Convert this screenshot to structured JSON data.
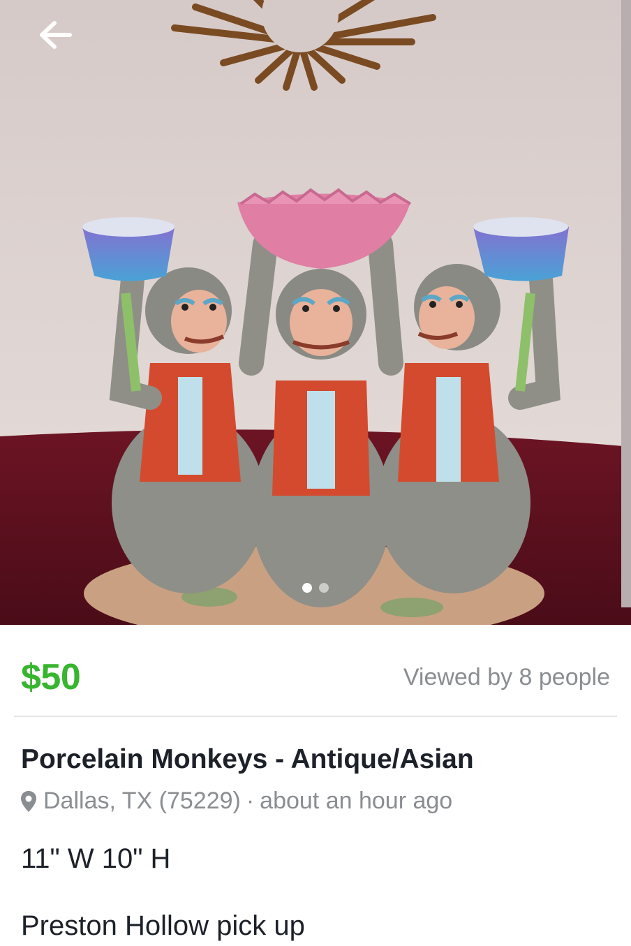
{
  "listing": {
    "price": "$50",
    "views": "Viewed by 8 people",
    "title": "Porcelain Monkeys - Antique/Asian",
    "location": "Dallas, TX (75229)",
    "separator": "·",
    "time": "about an hour ago",
    "description_lines": [
      "11\" W 10\" H",
      "Preston Hollow  pick up"
    ]
  },
  "gallery": {
    "image_count": 2,
    "current_index": 1
  },
  "icons": {
    "back": "back-arrow-icon",
    "location": "location-pin-icon"
  },
  "colors": {
    "price": "#37b52e",
    "muted_text": "#8a8d91",
    "primary_text": "#1d2129"
  }
}
